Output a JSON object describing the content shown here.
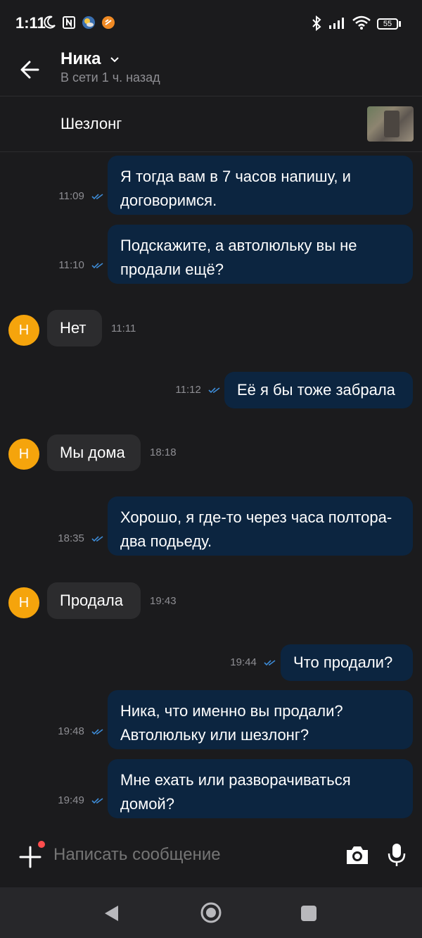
{
  "status_bar": {
    "time": "1:11",
    "battery": "55"
  },
  "header": {
    "contact_name": "Ника",
    "presence": "В сети 1 ч. назад"
  },
  "listing": {
    "title": "Шезлонг"
  },
  "messages": [
    {
      "direction": "out",
      "text": "Я тогда вам в 7 часов напишу, и договоримся.",
      "time": "11:09"
    },
    {
      "direction": "out",
      "text": "Подскажите, а автолюльку вы не продали ещё?",
      "time": "11:10"
    },
    {
      "direction": "in",
      "text": "Нет",
      "time": "11:11",
      "avatar": "Н"
    },
    {
      "direction": "out",
      "text": "Её я бы тоже забрала",
      "time": "11:12"
    },
    {
      "direction": "in",
      "text": "Мы дома",
      "time": "18:18",
      "avatar": "Н"
    },
    {
      "direction": "out",
      "text": "Хорошо, я где-то через часа полтора-два подьеду.",
      "time": "18:35"
    },
    {
      "direction": "in",
      "text": "Продала",
      "time": "19:43",
      "avatar": "Н"
    },
    {
      "direction": "out",
      "text": "Что продали?",
      "time": "19:44"
    },
    {
      "direction": "out",
      "text": "Ника, что именно вы продали? Автолюльку или шезлонг?",
      "time": "19:48"
    },
    {
      "direction": "out",
      "text": "Мне ехать или разворачиваться домой?",
      "time": "19:49"
    }
  ],
  "composer": {
    "placeholder": "Написать сообщение"
  },
  "colors": {
    "background": "#1b1b1d",
    "outgoing_bubble": "#0c2540",
    "incoming_bubble": "#2c2c2e",
    "avatar": "#f5a40c",
    "read_ticks": "#3d8bd6",
    "attach_dot": "#ff4d4d"
  }
}
